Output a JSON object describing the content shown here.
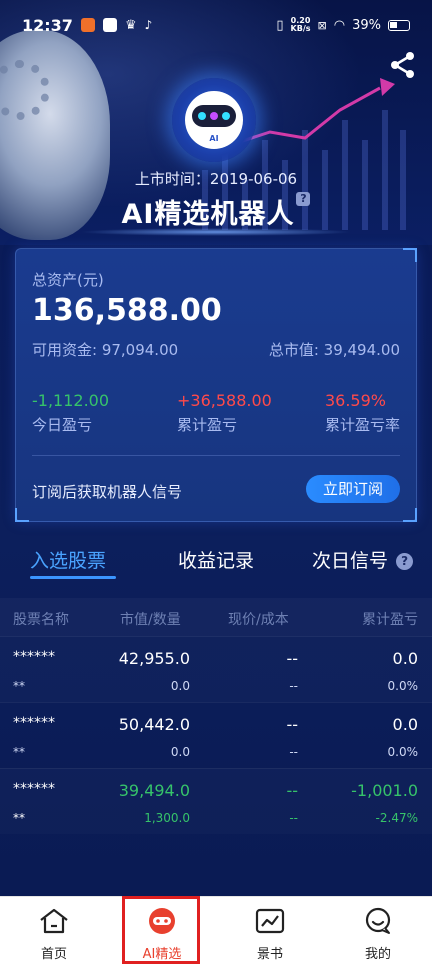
{
  "status_bar": {
    "time": "12:37",
    "net_speed_value": "0.20",
    "net_speed_unit": "KB/s",
    "battery": "39%"
  },
  "hero": {
    "avatar_label": "AI",
    "listing_date": "上市时间：2019-06-06",
    "robot_title": "AI精选机器人",
    "help_badge": "?"
  },
  "asset_card": {
    "total_label": "总资产(元)",
    "total_value": "136,588.00",
    "available_funds": "可用资金: 97,094.00",
    "market_value": "总市值: 39,494.00",
    "stats": [
      {
        "value": "-1,112.00",
        "label": "今日盈亏",
        "color": "#36c36a"
      },
      {
        "value": "+36,588.00",
        "label": "累计盈亏",
        "color": "#ff4a4a"
      },
      {
        "value": "36.59%",
        "label": "累计盈亏率",
        "color": "#ff4a4a"
      }
    ],
    "subscribe_text": "订阅后获取机器人信号",
    "subscribe_button": "立即订阅"
  },
  "tabs": [
    {
      "label": "入选股票",
      "active": true
    },
    {
      "label": "收益记录",
      "active": false
    },
    {
      "label": "次日信号",
      "active": false
    }
  ],
  "table": {
    "headers": [
      "股票名称",
      "市值/数量",
      "现价/成本",
      "累计盈亏"
    ],
    "rows": [
      {
        "name": "******",
        "code": "**",
        "market_value": "42,955.0",
        "quantity": "0.0",
        "price": "--",
        "cost": "--",
        "pnl": "0.0",
        "pnl_rate": "0.0%"
      },
      {
        "name": "******",
        "code": "**",
        "market_value": "50,442.0",
        "quantity": "0.0",
        "price": "--",
        "cost": "--",
        "pnl": "0.0",
        "pnl_rate": "0.0%"
      },
      {
        "name": "******",
        "code": "**",
        "market_value": "39,494.0",
        "quantity": "1,300.0",
        "price": "--",
        "cost": "--",
        "pnl": "-1,001.0",
        "pnl_rate": "-2.47%"
      }
    ]
  },
  "bottom_nav": [
    {
      "label": "首页",
      "icon": "home-icon"
    },
    {
      "label": "AI精选",
      "icon": "ai-robot-icon",
      "active": true
    },
    {
      "label": "景书",
      "icon": "chart-book-icon"
    },
    {
      "label": "我的",
      "icon": "profile-chat-icon"
    }
  ],
  "colors": {
    "accent_blue": "#3b95ff",
    "profit_red": "#ff4a4a",
    "loss_green": "#36c36a",
    "nav_active": "#e8402e"
  }
}
